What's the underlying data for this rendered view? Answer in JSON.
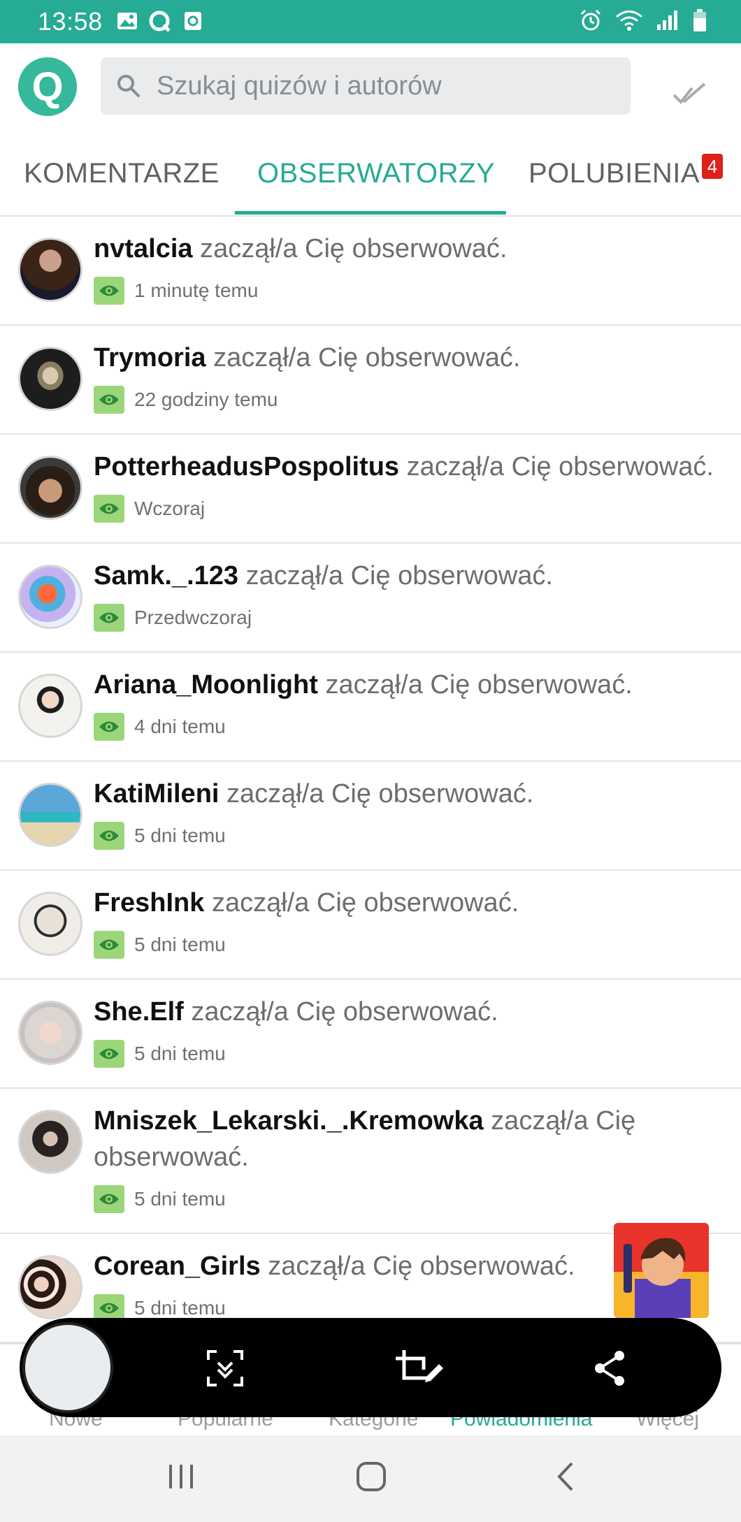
{
  "status_bar": {
    "time": "13:58"
  },
  "header": {
    "logo_letter": "Q",
    "search_placeholder": "Szukaj quizów i autorów"
  },
  "tabs": [
    {
      "label": "KOMENTARZE",
      "active": false
    },
    {
      "label": "OBSERWATORZY",
      "active": true
    },
    {
      "label": "POLUBIENIA",
      "active": false,
      "badge": "4"
    }
  ],
  "notifications": [
    {
      "user": "nvtalcia",
      "text": " zaczął/a Cię obserwować.",
      "when": "1 minutę temu"
    },
    {
      "user": "Trymoria",
      "text": " zaczął/a Cię obserwować.",
      "when": "22 godziny temu"
    },
    {
      "user": "PotterheadusPospolitus",
      "text": " zaczął/a Cię obserwować.",
      "when": "Wczoraj"
    },
    {
      "user": "Samk._.123",
      "text": " zaczął/a Cię obserwować.",
      "when": "Przedwczoraj"
    },
    {
      "user": "Ariana_Moonlight",
      "text": " zaczął/a Cię obserwować.",
      "when": "4 dni temu"
    },
    {
      "user": "KatiMileni",
      "text": " zaczął/a Cię obserwować.",
      "when": "5 dni temu"
    },
    {
      "user": "FreshInk",
      "text": " zaczął/a Cię obserwować.",
      "when": "5 dni temu"
    },
    {
      "user": "She.Elf",
      "text": " zaczął/a Cię obserwować.",
      "when": "5 dni temu"
    },
    {
      "user": "Mniszek_Lekarski._.Kremowka",
      "text": " zaczął/a Cię obserwować.",
      "when": "5 dni temu"
    },
    {
      "user": "Corean_Girls",
      "text": " zaczął/a Cię obserwować.",
      "when": "5 dni temu"
    }
  ],
  "bottom_nav": [
    {
      "label": "Nowe",
      "active": false
    },
    {
      "label": "Popularne",
      "active": false
    },
    {
      "label": "Kategorie",
      "active": false
    },
    {
      "label": "Powiadomienia",
      "active": true
    },
    {
      "label": "Więcej",
      "active": false
    }
  ],
  "colors": {
    "accent": "#26ab94",
    "badge": "#e0201a",
    "eye_badge": "#9bd77a"
  },
  "icons": {
    "status_left": [
      "gallery-icon",
      "quizzy-icon",
      "screen-record-icon"
    ],
    "status_right": [
      "alarm-icon",
      "wifi-icon",
      "signal-icon",
      "battery-icon"
    ],
    "header": [
      "search-icon",
      "mark-all-read-check-icon"
    ],
    "row_meta": "eye-icon",
    "overlay": [
      "scroll-capture-icon",
      "crop-edit-icon",
      "share-icon"
    ],
    "system_nav": [
      "recent-apps-icon",
      "home-icon",
      "back-icon"
    ]
  }
}
